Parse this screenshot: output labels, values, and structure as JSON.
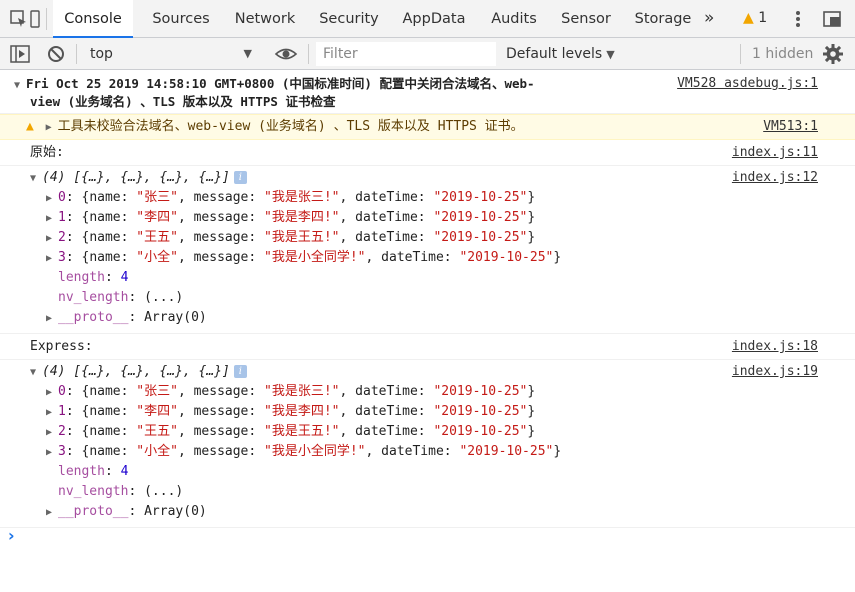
{
  "tabs": [
    "Console",
    "Sources",
    "Network",
    "Security",
    "AppData",
    "Audits",
    "Sensor",
    "Storage"
  ],
  "more_tabs": "»",
  "warning_count": "1",
  "toolbar": {
    "context": "top",
    "filter_placeholder": "Filter",
    "levels": "Default levels",
    "hidden": "1 hidden"
  },
  "group": {
    "header": "Fri Oct 25 2019 14:58:10 GMT+0800 (中国标准时间) 配置中关闭合法域名、web-",
    "header_line2": "view (业务域名) 、TLS 版本以及 HTTPS 证书检查",
    "source": "VM528 asdebug.js:1"
  },
  "warning": {
    "text": "工具未校验合法域名、web-view (业务域名) 、TLS 版本以及 HTTPS 证书。",
    "source": "VM513:1"
  },
  "log1": {
    "label": "原始:",
    "source": "index.js:11"
  },
  "log2": {
    "label": "Express:",
    "source": "index.js:18"
  },
  "array_summary": "(4) [{…}, {…}, {…}, {…}]",
  "array_sources": [
    "index.js:12",
    "index.js:19"
  ],
  "items": [
    {
      "idx": "0",
      "name": "\"张三\"",
      "message": "\"我是张三!\"",
      "dateTime": "\"2019-10-25\""
    },
    {
      "idx": "1",
      "name": "\"李四\"",
      "message": "\"我是李四!\"",
      "dateTime": "\"2019-10-25\""
    },
    {
      "idx": "2",
      "name": "\"王五\"",
      "message": "\"我是王五!\"",
      "dateTime": "\"2019-10-25\""
    },
    {
      "idx": "3",
      "name": "\"小全\"",
      "message": "\"我是小全同学!\"",
      "dateTime": "\"2019-10-25\""
    }
  ],
  "props": {
    "length_key": "length",
    "length_val": "4",
    "nv_key": "nv_length",
    "nv_val": "(...)",
    "proto_key": "__proto__",
    "proto_val": "Array(0)"
  },
  "prompt": "›"
}
